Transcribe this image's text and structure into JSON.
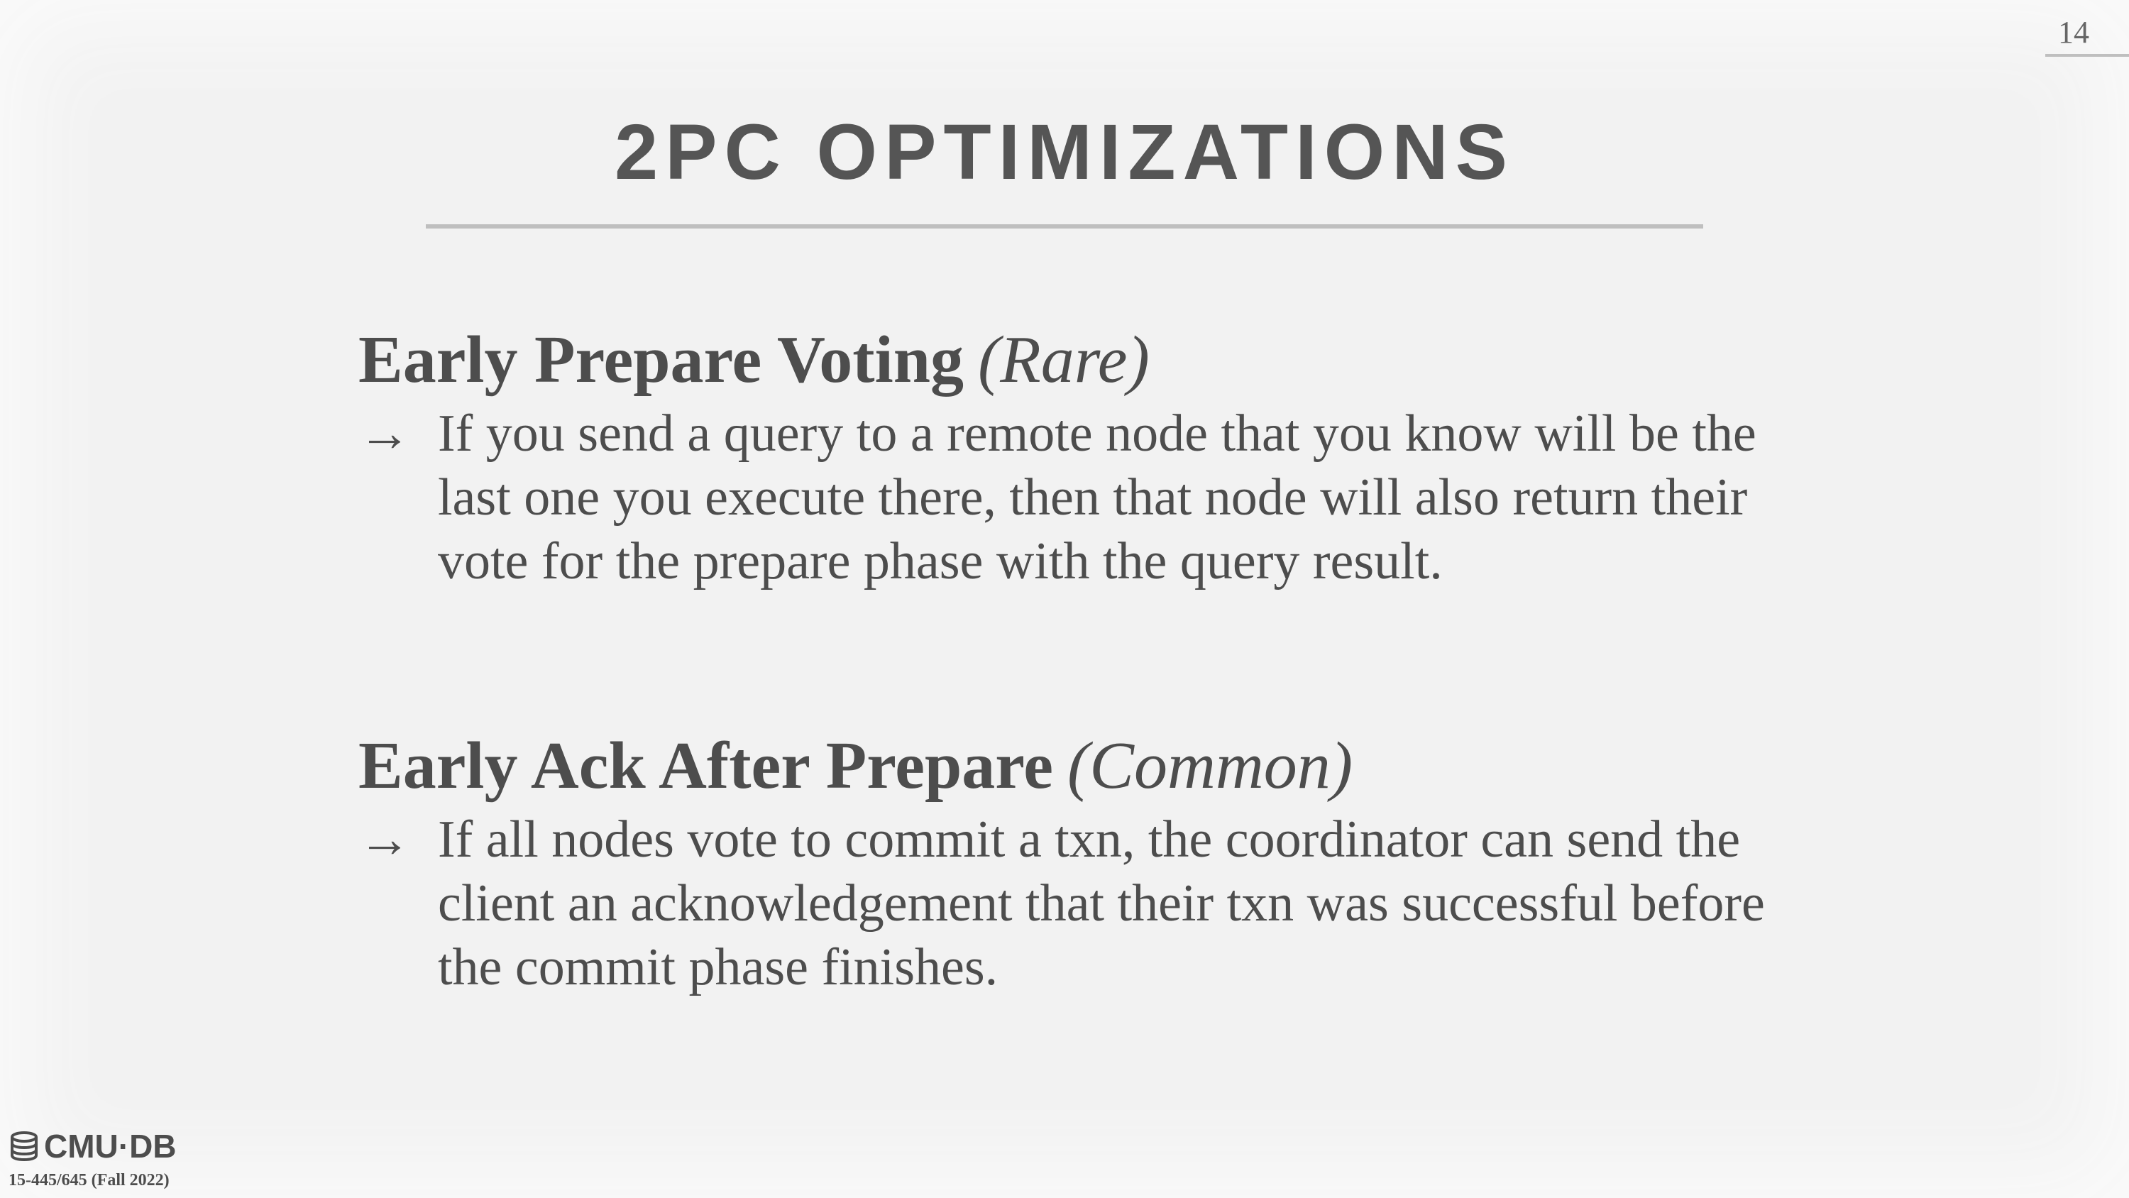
{
  "page_number": "14",
  "title": "2PC OPTIMIZATIONS",
  "sections": [
    {
      "heading": "Early Prepare Voting",
      "tag": "(Rare)",
      "bullet_icon": "arrow-right-icon",
      "bullet": "If you send a query to a remote node that you know will be the last one you execute there, then that node will also return their vote for the prepare phase with the query result."
    },
    {
      "heading": "Early Ack After Prepare",
      "tag": "(Common)",
      "bullet_icon": "arrow-right-icon",
      "bullet": "If all nodes vote to commit a txn, the coordinator can send the client an acknowledgement that their txn was successful before the commit phase finishes."
    }
  ],
  "footer": {
    "logo_text": "CMU·DB",
    "logo_icon": "database-icon",
    "course": "15-445/645 (Fall 2022)"
  }
}
